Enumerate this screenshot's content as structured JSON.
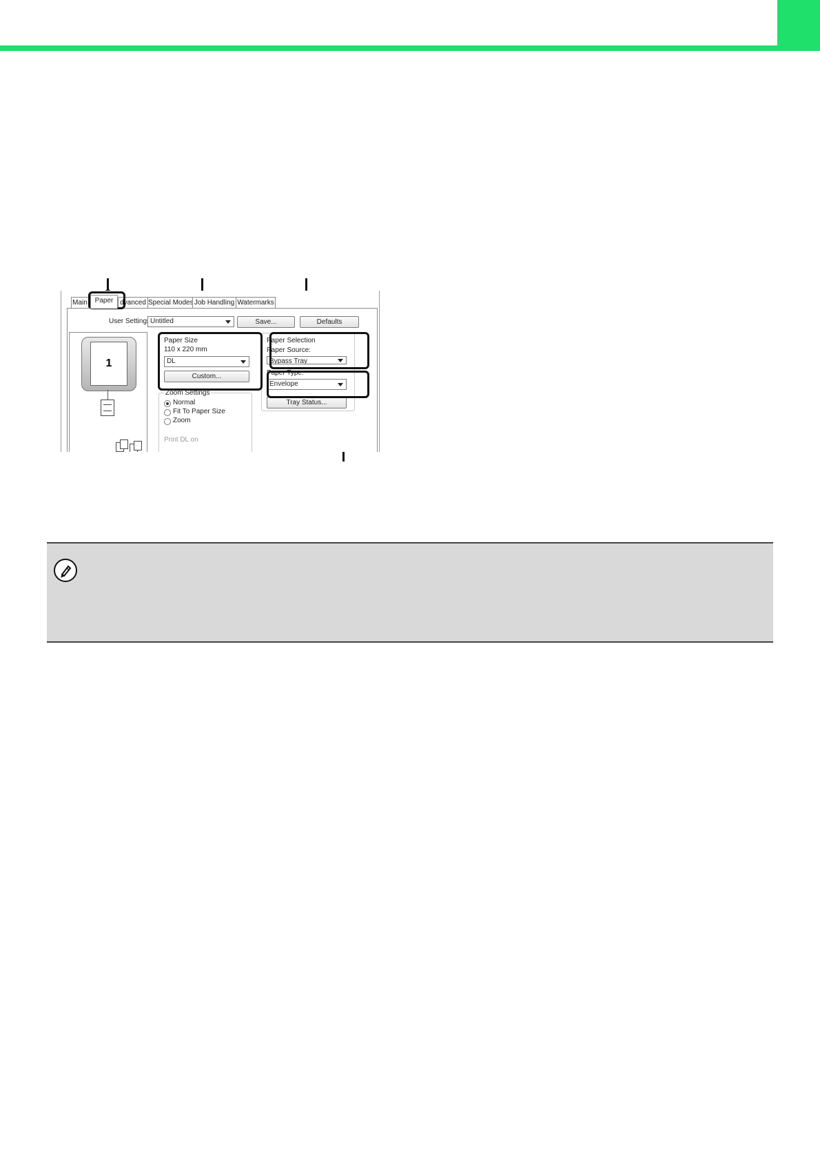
{
  "colors": {
    "accent": "#1ee06a",
    "note_bg": "#d9d9d9"
  },
  "tabs": [
    "Main",
    "Paper",
    "dvanced",
    "Special Modes",
    "Job Handling",
    "Watermarks"
  ],
  "user_settings": {
    "label": "User Settings:",
    "value": "Untitled",
    "save_label": "Save...",
    "defaults_label": "Defaults"
  },
  "paper_size": {
    "title": "Paper Size",
    "dimensions": "110 x 220 mm",
    "value": "DL",
    "custom_label": "Custom..."
  },
  "preview": {
    "page_number": "1"
  },
  "zoom_settings": {
    "title": "Zoom Settings",
    "options": [
      "Normal",
      "Fit To Paper Size",
      "Zoom"
    ],
    "selected": "Normal",
    "print_label": "Print DL on"
  },
  "paper_selection": {
    "title": "Paper Selection",
    "source_label": "Paper Source:",
    "source_value": "Bypass Tray",
    "type_label": "Paper Type:",
    "type_value": "Envelope",
    "tray_status_label": "Tray Status..."
  },
  "note": {
    "icon": "pencil-icon"
  }
}
